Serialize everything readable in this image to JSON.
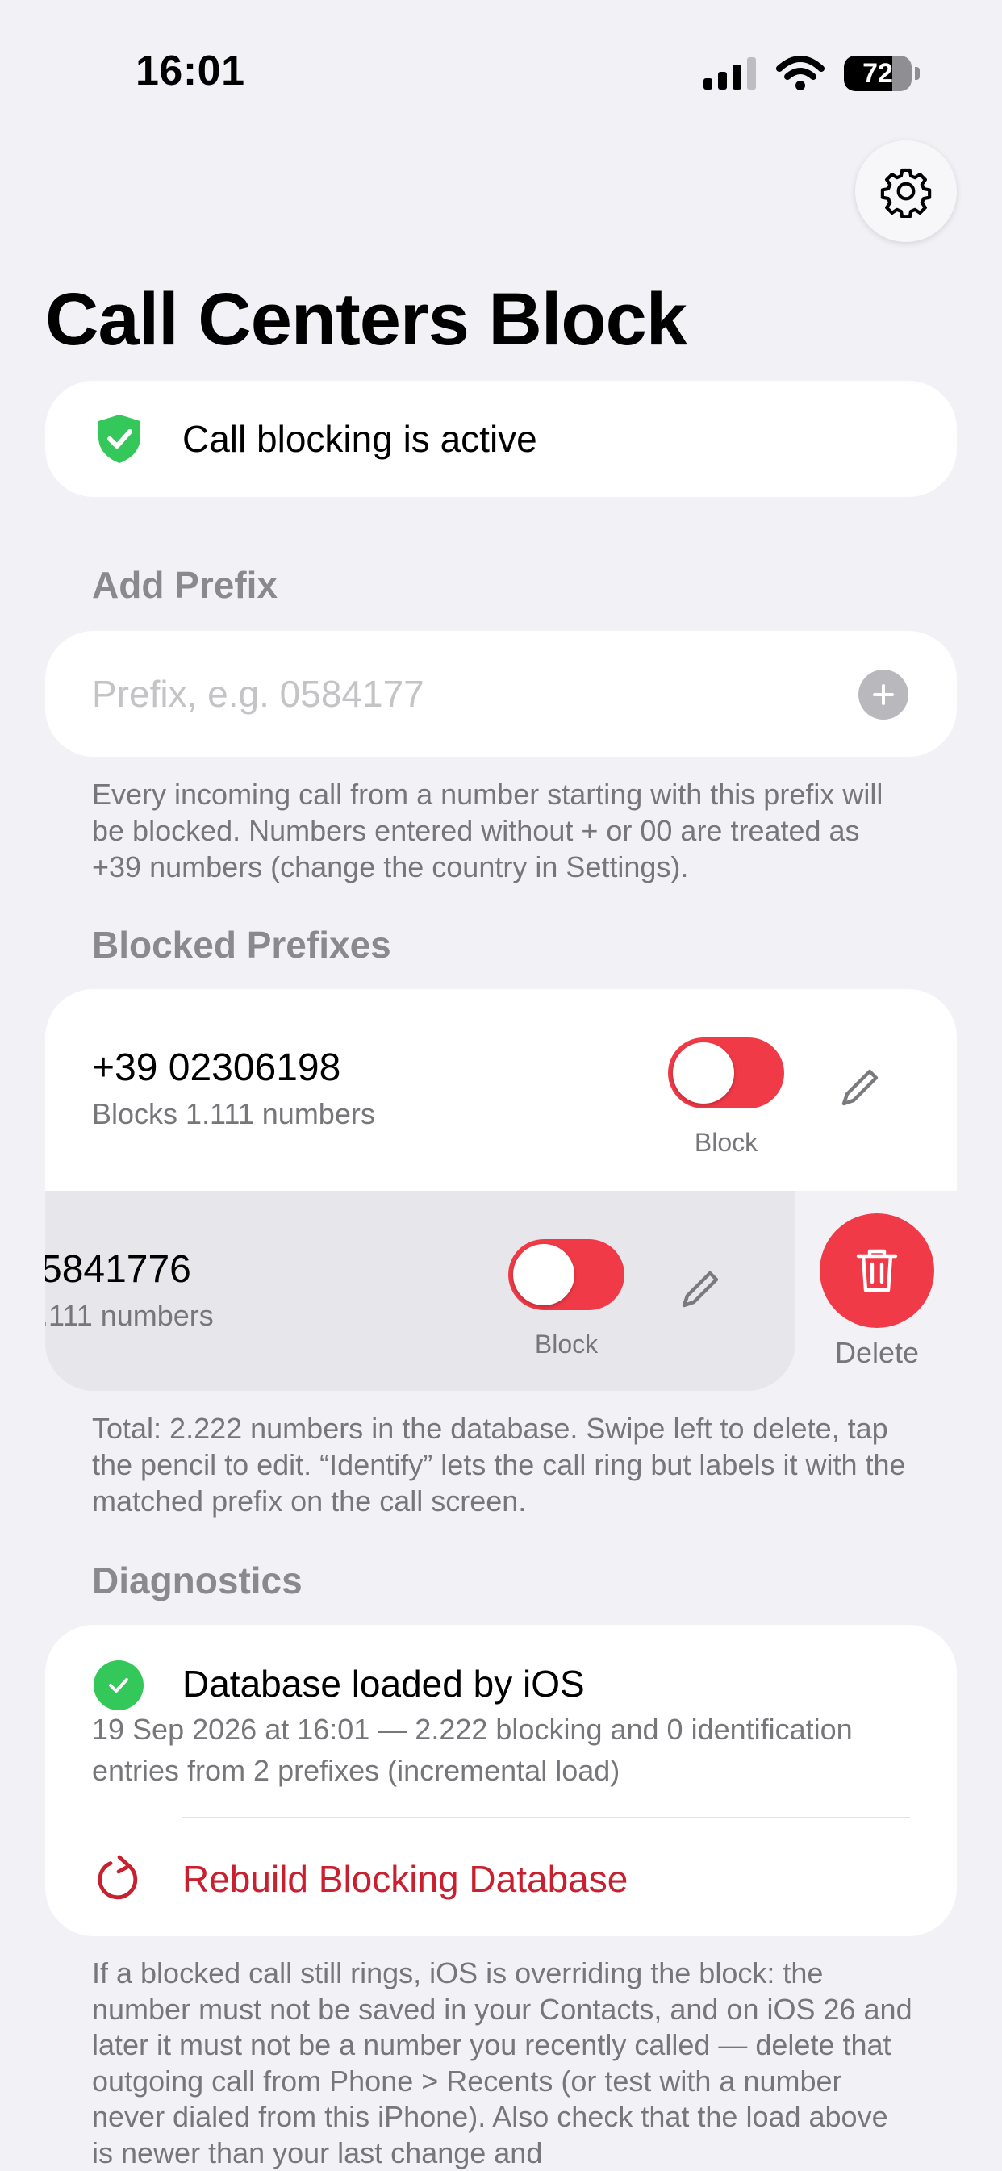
{
  "status_bar": {
    "time": "16:01",
    "battery": "72",
    "battery_level": 0.72
  },
  "header": {
    "title": "Call Centers Block",
    "settings_icon": "gear-icon"
  },
  "status": {
    "text": "Call blocking is active",
    "color": "#34c759"
  },
  "add_prefix": {
    "heading": "Add Prefix",
    "placeholder": "Prefix, e.g. 0584177",
    "value": "",
    "help": "Every incoming call from a number starting with this prefix will be blocked. Numbers entered without + or 00 are treated as +39 numbers (change the country in Settings)."
  },
  "blocked": {
    "heading": "Blocked Prefixes",
    "items": [
      {
        "number": "+39 02306198",
        "count": "Blocks 1.111 numbers",
        "toggle_label": "Block",
        "mode_on": true
      },
      {
        "number": "5841776",
        "count": ".111 numbers",
        "toggle_label": "Block",
        "mode_on": true
      }
    ],
    "delete_label": "Delete",
    "footer": "Total: 2.222 numbers in the database. Swipe left to delete, tap the pencil to edit. “Identify” lets the call ring but labels it with the matched prefix on the call screen."
  },
  "diagnostics": {
    "heading": "Diagnostics",
    "status_title": "Database loaded by iOS",
    "status_detail": "19 Sep 2026 at 16:01 — 2.222 blocking and 0 identification entries from 2 prefixes (incremental load)",
    "rebuild_label": "Rebuild Blocking Database",
    "footer": "If a blocked call still rings, iOS is overriding the block: the number must not be saved in your Contacts, and on iOS 26 and later it must not be a number you recently called — delete that outgoing call from Phone > Recents (or test with a number never dialed from this iPhone). Also check that the load above is newer than your last change and"
  },
  "colors": {
    "accent_red": "#f03a47",
    "rebuild_red": "#c8202f",
    "success_green": "#34c759",
    "background": "#f2f1f6"
  }
}
